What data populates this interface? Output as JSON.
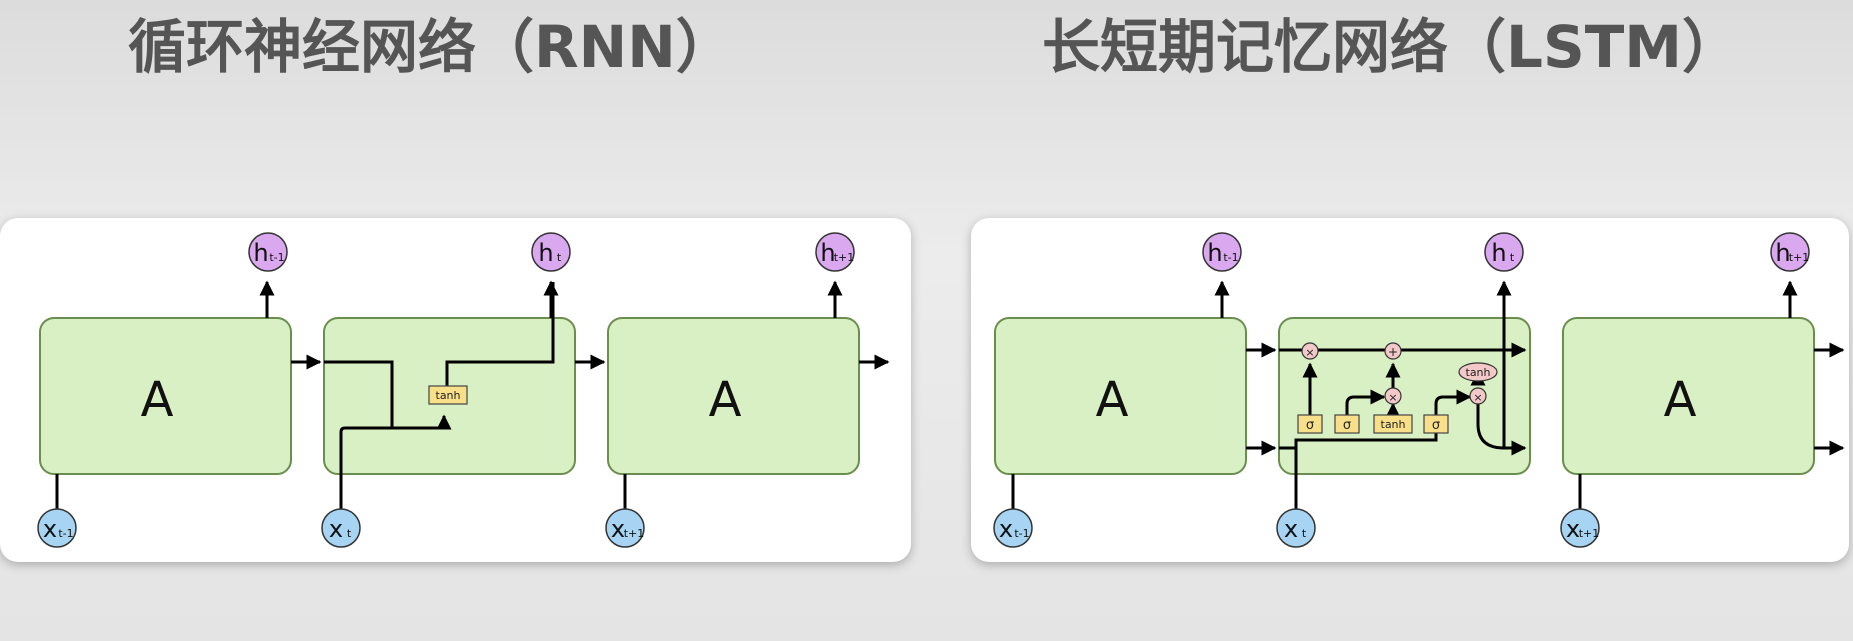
{
  "titles": {
    "rnn": "循环神经网络（RNN）",
    "lstm": "长短期记忆网络（LSTM）"
  },
  "diagram": {
    "cell_label": "A",
    "h": "h",
    "x": "x",
    "sub_prev": "t-1",
    "sub_cur": "t",
    "sub_next": "t+1",
    "tanh": "tanh",
    "sigma": "σ",
    "times": "×",
    "plus": "+"
  },
  "colors": {
    "cell_fill": "#d8f0c4",
    "cell_stroke": "#6a8e4e",
    "h_node": "#d9a8ee",
    "x_node": "#a6d4f2",
    "gate": "#f8e08a",
    "op_node": "#f3c8c8",
    "title": "#555555"
  }
}
